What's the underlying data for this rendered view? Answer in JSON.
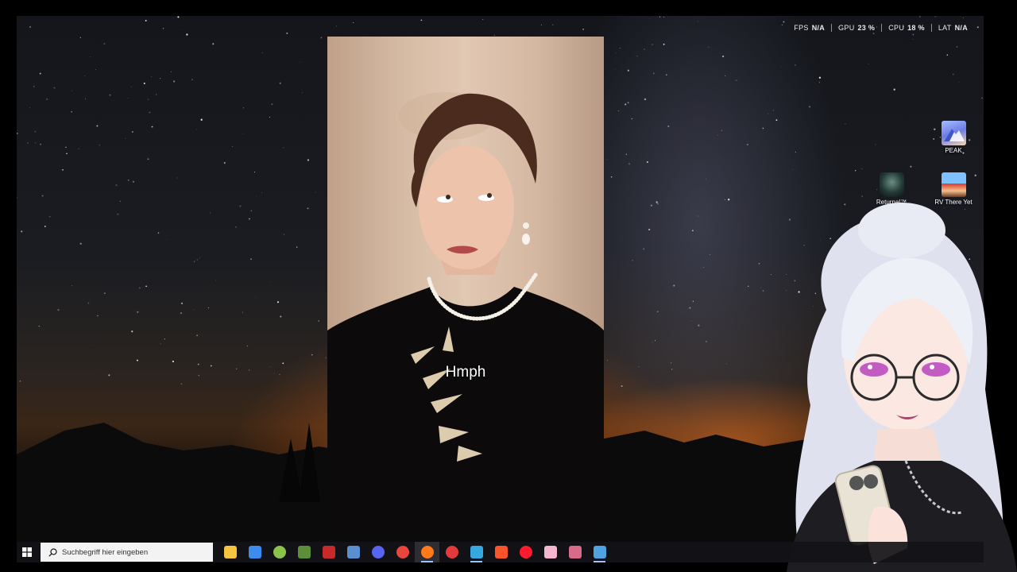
{
  "overlay": {
    "fps": {
      "label": "FPS",
      "value": "N/A"
    },
    "gpu": {
      "label": "GPU",
      "value": "23 %"
    },
    "cpu": {
      "label": "CPU",
      "value": "18 %"
    },
    "lat": {
      "label": "LAT",
      "value": "N/A"
    }
  },
  "desktop_icons": [
    {
      "label": "PEAK",
      "icon": "peak-app-icon"
    },
    {
      "label": "Returnal™",
      "icon": "returnal-app-icon"
    },
    {
      "label": "RV There Yet",
      "icon": "rv-there-yet-app-icon"
    }
  ],
  "video": {
    "caption": "Hmph"
  },
  "taskbar": {
    "search_placeholder": "Suchbegriff hier eingeben",
    "apps": [
      {
        "name": "file-explorer-icon",
        "color": "#f5c542"
      },
      {
        "name": "microsoft-store-icon",
        "color": "#3c8cf0"
      },
      {
        "name": "android-app-icon",
        "color": "#8bc34a"
      },
      {
        "name": "minecraft-icon",
        "color": "#5b8f3a"
      },
      {
        "name": "game-app-icon",
        "color": "#c8292b"
      },
      {
        "name": "steam-icon",
        "color": "#5a8fd0"
      },
      {
        "name": "discord-icon",
        "color": "#5865f2"
      },
      {
        "name": "chrome-icon",
        "color": "#e8453c"
      },
      {
        "name": "firefox-icon",
        "color": "#ff7a1a"
      },
      {
        "name": "performance-monitor-icon",
        "color": "#e33b3b"
      },
      {
        "name": "app-blue-swirl-icon",
        "color": "#35a8e0"
      },
      {
        "name": "brave-icon",
        "color": "#fb542b"
      },
      {
        "name": "opera-icon",
        "color": "#ff1b2d"
      },
      {
        "name": "pink-app-icon",
        "color": "#f4b6cf"
      },
      {
        "name": "pen-tool-icon",
        "color": "#d96b8a"
      },
      {
        "name": "steam-icon-2",
        "color": "#4fa3e0"
      }
    ]
  }
}
